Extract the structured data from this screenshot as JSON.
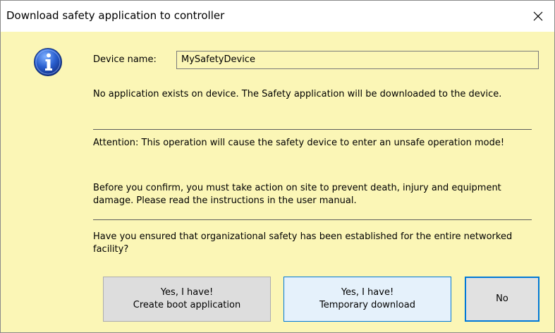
{
  "window": {
    "title": "Download safety application to controller",
    "close_symbol": "✕",
    "background_color": "#fbf6b6",
    "accent_color": "#0078d7"
  },
  "dialog": {
    "icon": "info-icon",
    "device_name_label": "Device name:",
    "device_name_value": "MySafetyDevice",
    "message_no_application": "No application exists on device. The Safety application will be downloaded to the device.",
    "message_attention": "Attention: This operation will cause the safety device to enter an unsafe operation mode!",
    "message_confirm": "Before you confirm, you must take action on site to prevent death, injury and equipment damage. Please read the instructions in the user manual.",
    "message_question": "Have you ensured that organizational safety has been established for the entire networked facility?"
  },
  "buttons": {
    "boot_line1": "Yes, I have!",
    "boot_line2": "Create boot application",
    "temp_line1": "Yes, I have!",
    "temp_line2": "Temporary download",
    "no_label": "No"
  }
}
